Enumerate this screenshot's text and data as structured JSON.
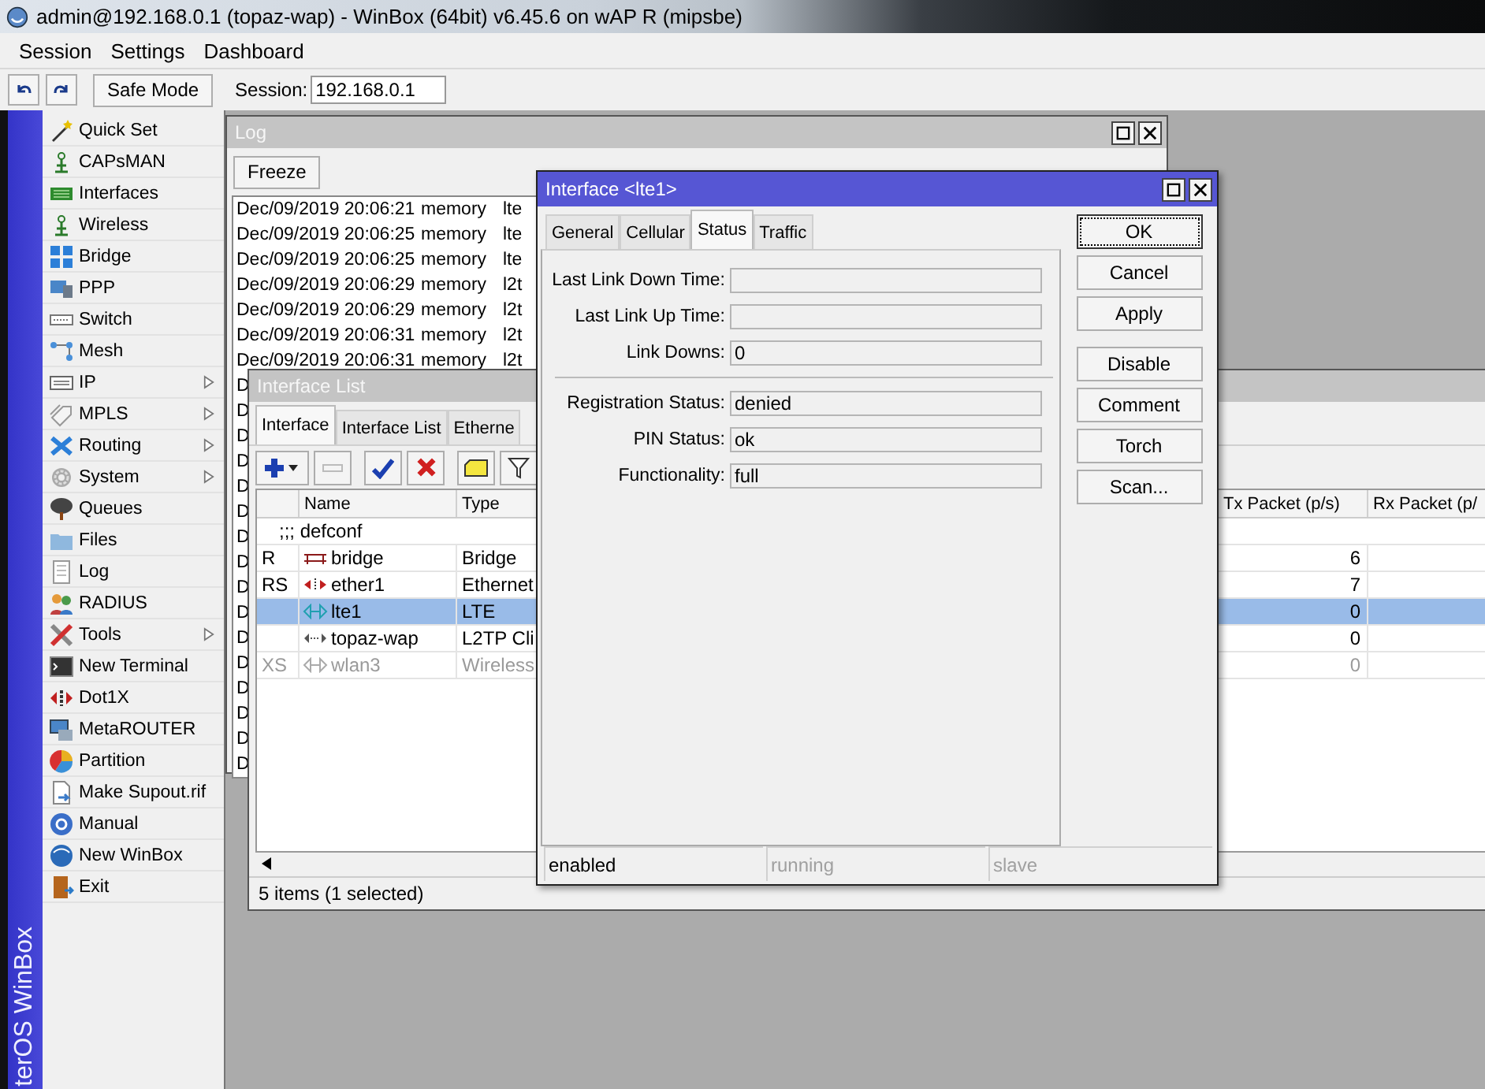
{
  "window": {
    "title": "admin@192.168.0.1 (topaz-wap) - WinBox (64bit) v6.45.6 on wAP R (mipsbe)"
  },
  "menu": [
    "Session",
    "Settings",
    "Dashboard"
  ],
  "toolbar": {
    "safe_mode": "Safe Mode",
    "session_label": "Session:",
    "session_value": "192.168.0.1"
  },
  "brand": "terOS WinBox",
  "sidebar": {
    "items": [
      {
        "label": "Quick Set",
        "submenu": false
      },
      {
        "label": "CAPsMAN",
        "submenu": false
      },
      {
        "label": "Interfaces",
        "submenu": false
      },
      {
        "label": "Wireless",
        "submenu": false
      },
      {
        "label": "Bridge",
        "submenu": false
      },
      {
        "label": "PPP",
        "submenu": false
      },
      {
        "label": "Switch",
        "submenu": false
      },
      {
        "label": "Mesh",
        "submenu": false
      },
      {
        "label": "IP",
        "submenu": true
      },
      {
        "label": "MPLS",
        "submenu": true
      },
      {
        "label": "Routing",
        "submenu": true
      },
      {
        "label": "System",
        "submenu": true
      },
      {
        "label": "Queues",
        "submenu": false
      },
      {
        "label": "Files",
        "submenu": false
      },
      {
        "label": "Log",
        "submenu": false
      },
      {
        "label": "RADIUS",
        "submenu": false
      },
      {
        "label": "Tools",
        "submenu": true
      },
      {
        "label": "New Terminal",
        "submenu": false
      },
      {
        "label": "Dot1X",
        "submenu": false
      },
      {
        "label": "MetaROUTER",
        "submenu": false
      },
      {
        "label": "Partition",
        "submenu": false
      },
      {
        "label": "Make Supout.rif",
        "submenu": false
      },
      {
        "label": "Manual",
        "submenu": false
      },
      {
        "label": "New WinBox",
        "submenu": false
      },
      {
        "label": "Exit",
        "submenu": false
      }
    ]
  },
  "log_window": {
    "title": "Log",
    "freeze": "Freeze",
    "rows": [
      {
        "time": "Dec/09/2019 20:06:21",
        "topic": "memory",
        "message": "lte"
      },
      {
        "time": "Dec/09/2019 20:06:25",
        "topic": "memory",
        "message": "lte"
      },
      {
        "time": "Dec/09/2019 20:06:25",
        "topic": "memory",
        "message": "lte"
      },
      {
        "time": "Dec/09/2019 20:06:29",
        "topic": "memory",
        "message": "l2t"
      },
      {
        "time": "Dec/09/2019 20:06:29",
        "topic": "memory",
        "message": "l2t"
      },
      {
        "time": "Dec/09/2019 20:06:31",
        "topic": "memory",
        "message": "l2t"
      },
      {
        "time": "Dec/09/2019 20:06:31",
        "topic": "memory",
        "message": "l2t"
      },
      {
        "time": "D"
      },
      {
        "time": "D"
      },
      {
        "time": "D"
      },
      {
        "time": "D"
      },
      {
        "time": "D"
      },
      {
        "time": "D"
      },
      {
        "time": "D"
      },
      {
        "time": "D"
      },
      {
        "time": "D"
      },
      {
        "time": "D"
      },
      {
        "time": "D"
      },
      {
        "time": "D"
      },
      {
        "time": "D"
      },
      {
        "time": "D"
      },
      {
        "time": "D"
      },
      {
        "time": "D"
      }
    ]
  },
  "interface_list": {
    "title": "Interface List",
    "tabs": [
      {
        "label": "Interface",
        "selected": true
      },
      {
        "label": "Interface List",
        "selected": false
      },
      {
        "label": "Etherne",
        "selected": false
      }
    ],
    "columns": {
      "name": "Name",
      "type": "Type",
      "tx": "Tx Packet (p/s)",
      "rx": "Rx Packet (p/"
    },
    "rows": [
      {
        "kind": "comment",
        "name": ";;; defconf",
        "selected": false,
        "disabled": false
      },
      {
        "kind": "bridge",
        "flags": "R",
        "name": "bridge",
        "type": "Bridge",
        "tx": "6",
        "selected": false,
        "disabled": false
      },
      {
        "kind": "ethernet",
        "flags": "RS",
        "name": "ether1",
        "type": "Ethernet",
        "tx": "7",
        "selected": false,
        "disabled": false
      },
      {
        "kind": "lte",
        "name": "lte1",
        "type": "LTE",
        "tx": "0",
        "selected": true,
        "disabled": false
      },
      {
        "kind": "l2tp",
        "name": "topaz-wap",
        "type": "L2TP Cli",
        "tx": "0",
        "selected": false,
        "disabled": false
      },
      {
        "kind": "wireless",
        "flags": "XS",
        "name": "wlan3",
        "type": "Wireless",
        "tx": "0",
        "selected": false,
        "disabled": true
      }
    ],
    "status": "5 items (1 selected)"
  },
  "dialog": {
    "title": "Interface <lte1>",
    "tabs": [
      {
        "label": "General",
        "selected": false
      },
      {
        "label": "Cellular",
        "selected": false
      },
      {
        "label": "Status",
        "selected": true
      },
      {
        "label": "Traffic",
        "selected": false
      }
    ],
    "field_groups": [
      [
        {
          "label": "Last Link Down Time:"
        },
        {
          "label": "Last Link Up Time:"
        },
        {
          "label": "Link Downs:",
          "value": "0"
        }
      ],
      [
        {
          "label": "Registration Status:",
          "value": "denied"
        },
        {
          "label": "PIN Status:",
          "value": "ok"
        },
        {
          "label": "Functionality:",
          "value": "full"
        }
      ]
    ],
    "button_groups": [
      [
        {
          "label": "OK",
          "focused": true
        },
        {
          "label": "Cancel",
          "focused": false
        },
        {
          "label": "Apply",
          "focused": false
        }
      ],
      [
        {
          "label": "Disable",
          "focused": false
        },
        {
          "label": "Comment",
          "focused": false
        },
        {
          "label": "Torch",
          "focused": false
        },
        {
          "label": "Scan...",
          "focused": false
        }
      ]
    ],
    "status": [
      {
        "text": "enabled",
        "active": true
      },
      {
        "text": "running",
        "active": false
      },
      {
        "text": "slave",
        "active": false
      }
    ]
  }
}
